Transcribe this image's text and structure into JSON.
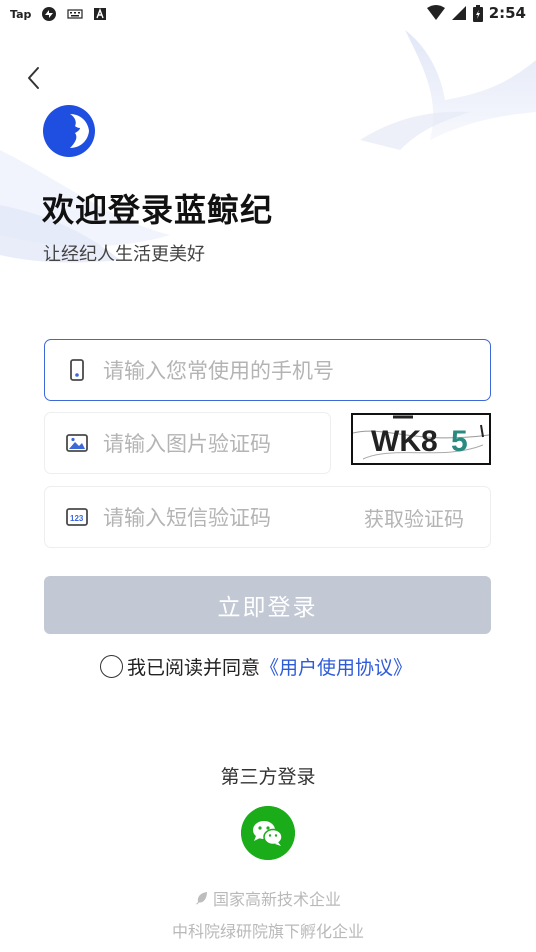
{
  "status_bar": {
    "carrier_text": "Tap",
    "time": "2:54",
    "icons": [
      "sync-icon",
      "keyboard-icon",
      "a-icon",
      "wifi-icon",
      "signal-icon",
      "battery-icon"
    ]
  },
  "header": {
    "title": "欢迎登录蓝鲸纪",
    "subtitle": "让经纪人生活更美好"
  },
  "form": {
    "phone_placeholder": "请输入您常使用的手机号",
    "image_code_placeholder": "请输入图片验证码",
    "captcha_text": "WK85",
    "sms_code_placeholder": "请输入短信验证码",
    "sms_button": "获取验证码",
    "login_button": "立即登录"
  },
  "agreement": {
    "prefix": "我已阅读并同意",
    "link": "《用户使用协议》"
  },
  "third_party": {
    "label": "第三方登录"
  },
  "footer": {
    "line1": "国家高新技术企业",
    "line2": "中科院绿研院旗下孵化企业"
  },
  "colors": {
    "accent": "#2e5bd8",
    "logo": "#1f4fe0",
    "button_disabled": "#c2c8d4",
    "wechat": "#1aad19"
  }
}
